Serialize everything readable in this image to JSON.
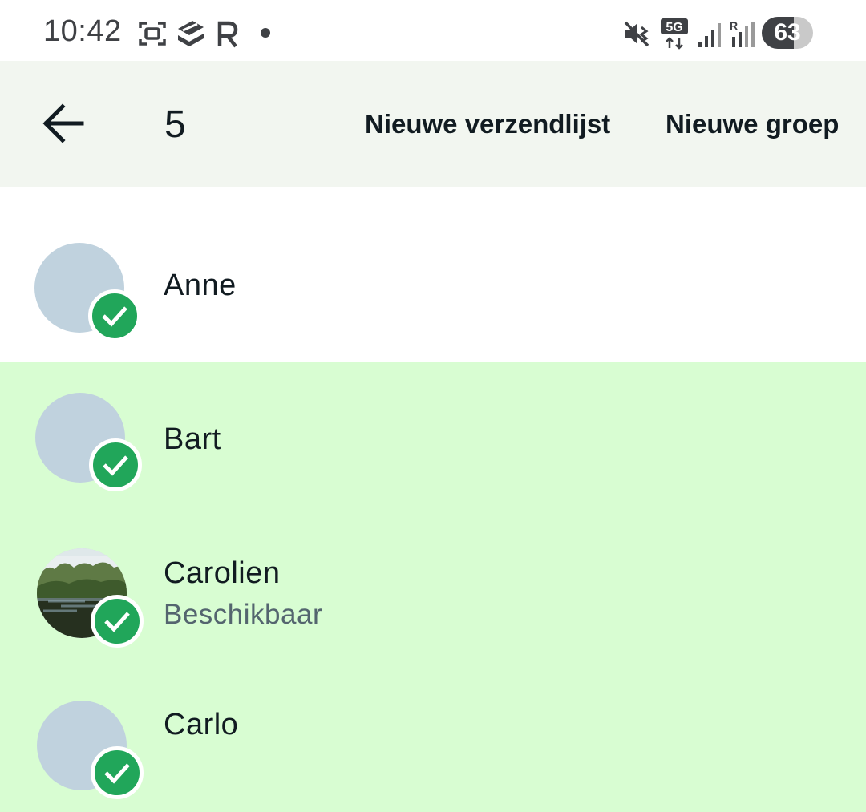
{
  "status_bar": {
    "time": "10:42",
    "network": "5G",
    "roaming": "R",
    "battery_percent": "63",
    "battery_level": 0.63,
    "icons_left": [
      "screenshot-icon",
      "stacked-app-icon",
      "r-app-icon",
      "dot-icon"
    ],
    "icons_right": [
      "vibrate-mute-icon",
      "5g-icon",
      "signal-icon",
      "signal-roaming-icon"
    ]
  },
  "app_bar": {
    "back_icon": "arrow-left-icon",
    "selected_count": "5",
    "new_broadcast_label": "Nieuwe verzendlijst",
    "new_group_label": "Nieuwe groep"
  },
  "contacts": [
    {
      "name": "Anne",
      "status": "",
      "selected": true,
      "row_highlighted": false,
      "avatar": "default"
    },
    {
      "name": "Bart",
      "status": "",
      "selected": true,
      "row_highlighted": true,
      "avatar": "default"
    },
    {
      "name": "Carolien",
      "status": "Beschikbaar",
      "selected": true,
      "row_highlighted": true,
      "avatar": "photo-lake"
    },
    {
      "name": "Carlo",
      "status": "",
      "selected": true,
      "row_highlighted": true,
      "avatar": "default"
    }
  ],
  "colors": {
    "app_bar_bg": "#f2f6f0",
    "selected_row_bg": "#d8fdd2",
    "check_green": "#21a65a",
    "avatar_placeholder": "#c0d2de"
  }
}
